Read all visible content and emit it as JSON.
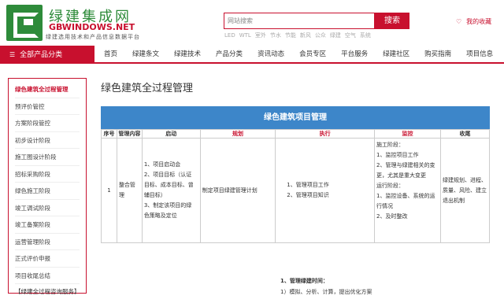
{
  "header": {
    "logo_cn": "绿建集成网",
    "logo_en": "GBWINDOWS.NET",
    "slogan": "绿建选用技术和产品信息数据平台",
    "search_placeholder": "网站搜索",
    "search_button": "搜索",
    "hot_words": [
      "LED",
      "WTL",
      "室外",
      "节水",
      "节能",
      "新风",
      "公众",
      "绿建",
      "空气",
      "系统"
    ],
    "favorite": "我的收藏"
  },
  "nav": {
    "category": "全部产品分类",
    "items": [
      "首页",
      "绿建条文",
      "绿建技术",
      "产品分类",
      "资讯动态",
      "会员专区",
      "平台服务",
      "绿建社区",
      "购买指南",
      "项目信息"
    ]
  },
  "sidebar": {
    "items": [
      "绿色建筑全过程管理",
      "预评价管控",
      "方案阶段管控",
      "初步设计阶段",
      "施工图设计阶段",
      "招标采购阶段",
      "绿色施工阶段",
      "竣工调试阶段",
      "竣工备案阶段",
      "运营管理阶段",
      "正式评价申报",
      "项目收尾总结"
    ],
    "more": "【绿建全过程咨询服务】"
  },
  "main": {
    "title": "绿色建筑全过程管理",
    "banner": "绿色建筑项目管理",
    "headers": [
      "序号",
      "管理内容",
      "启动",
      "规划",
      "执行",
      "监控",
      "收尾"
    ],
    "row": {
      "seq": "1",
      "content": "整合管理",
      "start": [
        "1、项目启动会",
        "2、项目目标（认证",
        "目标、成本目标、曾",
        "辅目标）",
        "3、制定该项目的绿",
        "色策略及定位"
      ],
      "plan": "制定项目绿建管理计划",
      "exec": [
        "1、管理项目工作",
        "2、管理项目知识"
      ],
      "monitor": [
        "施工阶段：",
        "1、监控项目工作",
        "2、管理与绿建相关的变",
        "更，尤其是重大变更",
        "运行阶段：",
        "1、监控设备、系统的运",
        "行情况",
        "2、及时整改"
      ],
      "close": [
        "绿建规划、进程、",
        "质量、风险、建立",
        "退出机制"
      ]
    },
    "below": [
      "1、管理绿建时间：",
      "1）模拟、分析、计算，提出优化方案"
    ]
  }
}
